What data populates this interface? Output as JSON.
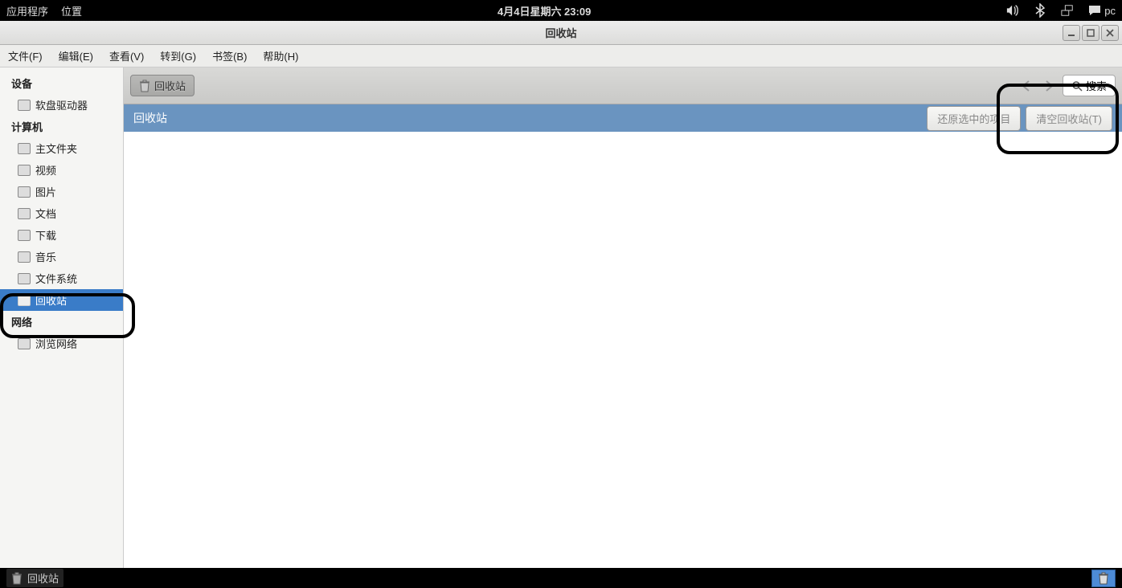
{
  "top_panel": {
    "applications": "应用程序",
    "places": "位置",
    "datetime": "4月4日星期六 23:09",
    "username": "pc"
  },
  "window": {
    "title": "回收站"
  },
  "menubar": {
    "file": "文件(F)",
    "edit": "编辑(E)",
    "view": "查看(V)",
    "go": "转到(G)",
    "bookmarks": "书签(B)",
    "help": "帮助(H)"
  },
  "sidebar": {
    "devices_header": "设备",
    "devices": [
      {
        "label": "软盘驱动器"
      }
    ],
    "computer_header": "计算机",
    "computer": [
      {
        "label": "主文件夹"
      },
      {
        "label": "视频"
      },
      {
        "label": "图片"
      },
      {
        "label": "文档"
      },
      {
        "label": "下载"
      },
      {
        "label": "音乐"
      },
      {
        "label": "文件系统"
      },
      {
        "label": "回收站",
        "selected": true
      }
    ],
    "network_header": "网络",
    "network": [
      {
        "label": "浏览网络"
      }
    ]
  },
  "pathbar": {
    "location": "回收站",
    "search_label": "搜索"
  },
  "actionbar": {
    "title": "回收站",
    "restore": "还原选中的项目",
    "empty": "清空回收站(T)"
  },
  "taskbar": {
    "app": "回收站"
  }
}
